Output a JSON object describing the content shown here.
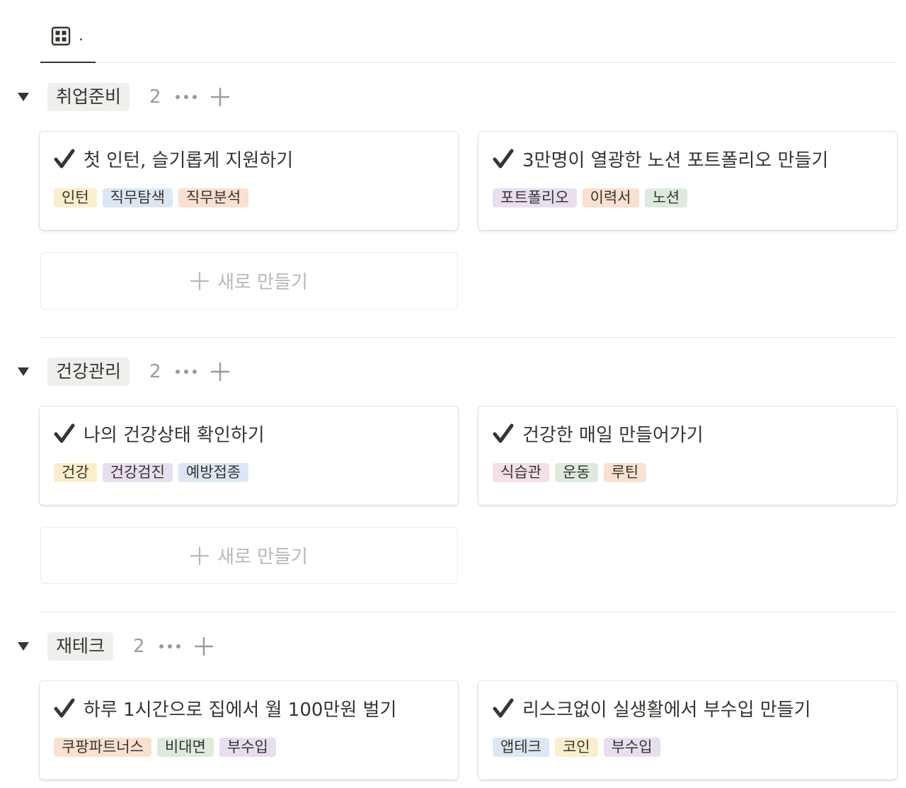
{
  "view": {
    "tab_label": ".",
    "tab_icon": "table-icon"
  },
  "new_item_label": "새로 만들기",
  "groups": [
    {
      "name": "취업준비",
      "count": "2",
      "cards": [
        {
          "title": "첫 인턴, 슬기롭게 지원하기",
          "tags": [
            {
              "label": "인턴",
              "color": "#fbeecc"
            },
            {
              "label": "직무탐색",
              "color": "#dbe8f3"
            },
            {
              "label": "직무분석",
              "color": "#f9e0d0"
            }
          ]
        },
        {
          "title": "3만명이 열광한 노션 포트폴리오 만들기",
          "tags": [
            {
              "label": "포트폴리오",
              "color": "#e8deee"
            },
            {
              "label": "이력서",
              "color": "#f9e0d0"
            },
            {
              "label": "노션",
              "color": "#dcebdc"
            }
          ]
        }
      ]
    },
    {
      "name": "건강관리",
      "count": "2",
      "cards": [
        {
          "title": "나의 건강상태 확인하기",
          "tags": [
            {
              "label": "건강",
              "color": "#fbeecc"
            },
            {
              "label": "건강검진",
              "color": "#e8deee"
            },
            {
              "label": "예방접종",
              "color": "#dbe8f3"
            }
          ]
        },
        {
          "title": "건강한 매일 만들어가기",
          "tags": [
            {
              "label": "식습관",
              "color": "#f4e0e8"
            },
            {
              "label": "운동",
              "color": "#dcebdc"
            },
            {
              "label": "루틴",
              "color": "#f9e0d0"
            }
          ]
        }
      ]
    },
    {
      "name": "재테크",
      "count": "2",
      "cards": [
        {
          "title": "하루 1시간으로 집에서 월 100만원 벌기",
          "tags": [
            {
              "label": "쿠팡파트너스",
              "color": "#f9e0d0"
            },
            {
              "label": "비대면",
              "color": "#dcebdc"
            },
            {
              "label": "부수입",
              "color": "#e8deee"
            }
          ]
        },
        {
          "title": "리스크없이 실생활에서 부수입 만들기",
          "tags": [
            {
              "label": "앱테크",
              "color": "#dbe8f3"
            },
            {
              "label": "코인",
              "color": "#fbeecc"
            },
            {
              "label": "부수입",
              "color": "#e8deee"
            }
          ]
        }
      ]
    }
  ]
}
